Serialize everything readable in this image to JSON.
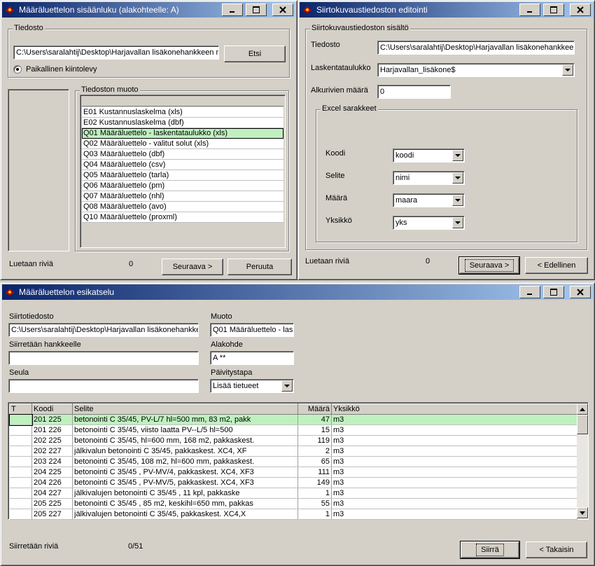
{
  "win1": {
    "title": "Määräluettelon sisäänluku (alakohteelle: A)",
    "tiedosto_caption": "Tiedosto",
    "path": "C:\\Users\\saralahtij\\Desktop\\Harjavallan lisäkonehankkeen m",
    "etsi_label": "Etsi",
    "radio_label": "Paikallinen kiintolevy",
    "muoto_caption": "Tiedoston muoto",
    "formats": [
      "E01 Kustannuslaskelma (xls)",
      "E02 Kustannuslaskelma (dbf)",
      "Q01 Määräluettelo - laskentataulukko (xls)",
      "Q02 Määräluettelo - valitut solut (xls)",
      "Q03 Määräluettelo (dbf)",
      "Q04 Määräluettelo (csv)",
      "Q05 Määräluettelo (tarla)",
      "Q06 Määräluettelo (pm)",
      "Q07 Määräluettelo (nhl)",
      "Q08 Määräluettelo (avo)",
      "Q10 Määräluettelo (proxml)"
    ],
    "selected_index": 2,
    "luetaan_label": "Luetaan riviä",
    "luetaan_value": "0",
    "next_label": "Seuraava >",
    "cancel_label": "Peruuta"
  },
  "win2": {
    "title": "Siirtokuvaustiedoston editointi",
    "group_caption": "Siirtokuvaustiedoston sisältö",
    "tiedosto_label": "Tiedosto",
    "tiedosto_value": "C:\\Users\\saralahtij\\Desktop\\Harjavallan lisäkonehankkee",
    "laskenta_label": "Laskentataulukko",
    "laskenta_value": "Harjavallan_lisäkone$",
    "alkurivit_label": "Alkurivien määrä",
    "alkurivit_value": "0",
    "excel_caption": "Excel sarakkeet",
    "fields": [
      {
        "label": "Koodi",
        "value": "koodi"
      },
      {
        "label": "Selite",
        "value": "nimi"
      },
      {
        "label": "Määrä",
        "value": "maara"
      },
      {
        "label": "Yksikkö",
        "value": "yks"
      }
    ],
    "luetaan_label": "Luetaan riviä",
    "luetaan_value": "0",
    "next_label": "Seuraava >",
    "back_label": "< Edellinen"
  },
  "win3": {
    "title": "Määräluettelon esikatselu",
    "siirtotiedosto_label": "Siirtotiedosto",
    "siirtotiedosto_value": "C:\\Users\\saralahtij\\Desktop\\Harjavallan lisäkonehankke",
    "muoto_label": "Muoto",
    "muoto_value": "Q01 Määräluettelo - lask",
    "hanke_label": "Siirretään hankkeelle",
    "hanke_value": "",
    "alakohde_label": "Alakohde",
    "alakohde_value": "A **",
    "seula_label": "Seula",
    "seula_value": "",
    "paivitys_label": "Päivitystapa",
    "paivitys_value": "Lisää tietueet",
    "columns": [
      "T",
      "Koodi",
      "Selite",
      "Määrä",
      "Yksikkö"
    ],
    "rows": [
      {
        "t": "",
        "koodi": "201 225",
        "selite": "betonointi C 35/45, PV-L/7  hl=500 mm, 83 m2, pakk",
        "maara": "47",
        "yks": "m3"
      },
      {
        "t": "",
        "koodi": "201 226",
        "selite": "betonointi C 35/45, viisto laatta PV--L/5  hl=500",
        "maara": "15",
        "yks": "m3"
      },
      {
        "t": "",
        "koodi": "202 225",
        "selite": "betonointi C 35/45, hl=600 mm, 168 m2, pakkaskest.",
        "maara": "119",
        "yks": "m3"
      },
      {
        "t": "",
        "koodi": "202 227",
        "selite": "jälkivalun betonointi C 35/45, pakkaskest. XC4, XF",
        "maara": "2",
        "yks": "m3"
      },
      {
        "t": "",
        "koodi": "203 224",
        "selite": "betonointi C 35/45, 108 m2, hl=600 mm, pakkaskest.",
        "maara": "65",
        "yks": "m3"
      },
      {
        "t": "",
        "koodi": "204 225",
        "selite": "betonointi C 35/45 , PV-MV/4, pakkaskest. XC4, XF3",
        "maara": "111",
        "yks": "m3"
      },
      {
        "t": "",
        "koodi": "204 226",
        "selite": "betonointi C 35/45 , PV-MV/5, pakkaskest. XC4, XF3",
        "maara": "149",
        "yks": "m3"
      },
      {
        "t": "",
        "koodi": "204 227",
        "selite": "jälkivalujen betonointi C 35/45 , 11 kpl, pakkaske",
        "maara": "1",
        "yks": "m3"
      },
      {
        "t": "",
        "koodi": "205 225",
        "selite": "betonointi C 35/45 , 85 m2, keskihl=650 mm, pakkas",
        "maara": "55",
        "yks": "m3"
      },
      {
        "t": "",
        "koodi": "205 227",
        "selite": "jälkivalujen betonointi C 35/45, pakkaskest. XC4,X",
        "maara": "1",
        "yks": "m3"
      }
    ],
    "siirretaan_label": "Siirretään riviä",
    "siirretaan_value": "0/51",
    "siirra_label": "Siirrä",
    "back_label": "< Takaisin"
  }
}
